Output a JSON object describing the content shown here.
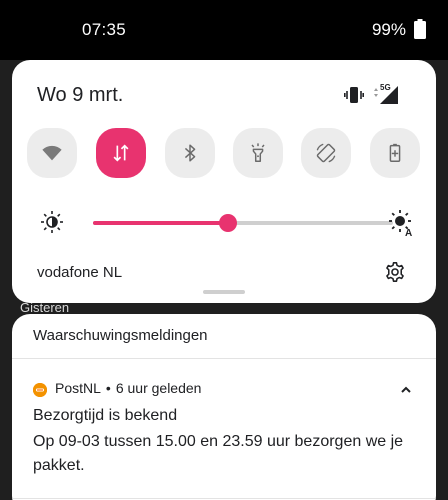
{
  "status_bar": {
    "time": "07:35",
    "battery_percent": "99%"
  },
  "quick_settings": {
    "date": "Wo 9 mrt.",
    "network_type": "5G",
    "tiles": [
      {
        "id": "wifi",
        "icon": "wifi-icon",
        "active": false
      },
      {
        "id": "mobile-data",
        "icon": "mobile-data-icon",
        "active": true
      },
      {
        "id": "bluetooth",
        "icon": "bluetooth-icon",
        "active": false
      },
      {
        "id": "flashlight",
        "icon": "flashlight-icon",
        "active": false
      },
      {
        "id": "auto-rotate",
        "icon": "auto-rotate-icon",
        "active": false
      },
      {
        "id": "battery-saver",
        "icon": "battery-saver-icon",
        "active": false
      }
    ],
    "brightness_level": 0.45,
    "carrier": "vodafone NL",
    "accent_color": "#e8336f"
  },
  "background_label": "Gisteren",
  "notification": {
    "header": "Waarschuwingsmeldingen",
    "app_name": "PostNL",
    "separator": "•",
    "time": "6 uur geleden",
    "title": "Bezorgtijd is bekend",
    "body": "Op 09-03 tussen 15.00 en 23.59 uur bezorgen we je pakket."
  }
}
